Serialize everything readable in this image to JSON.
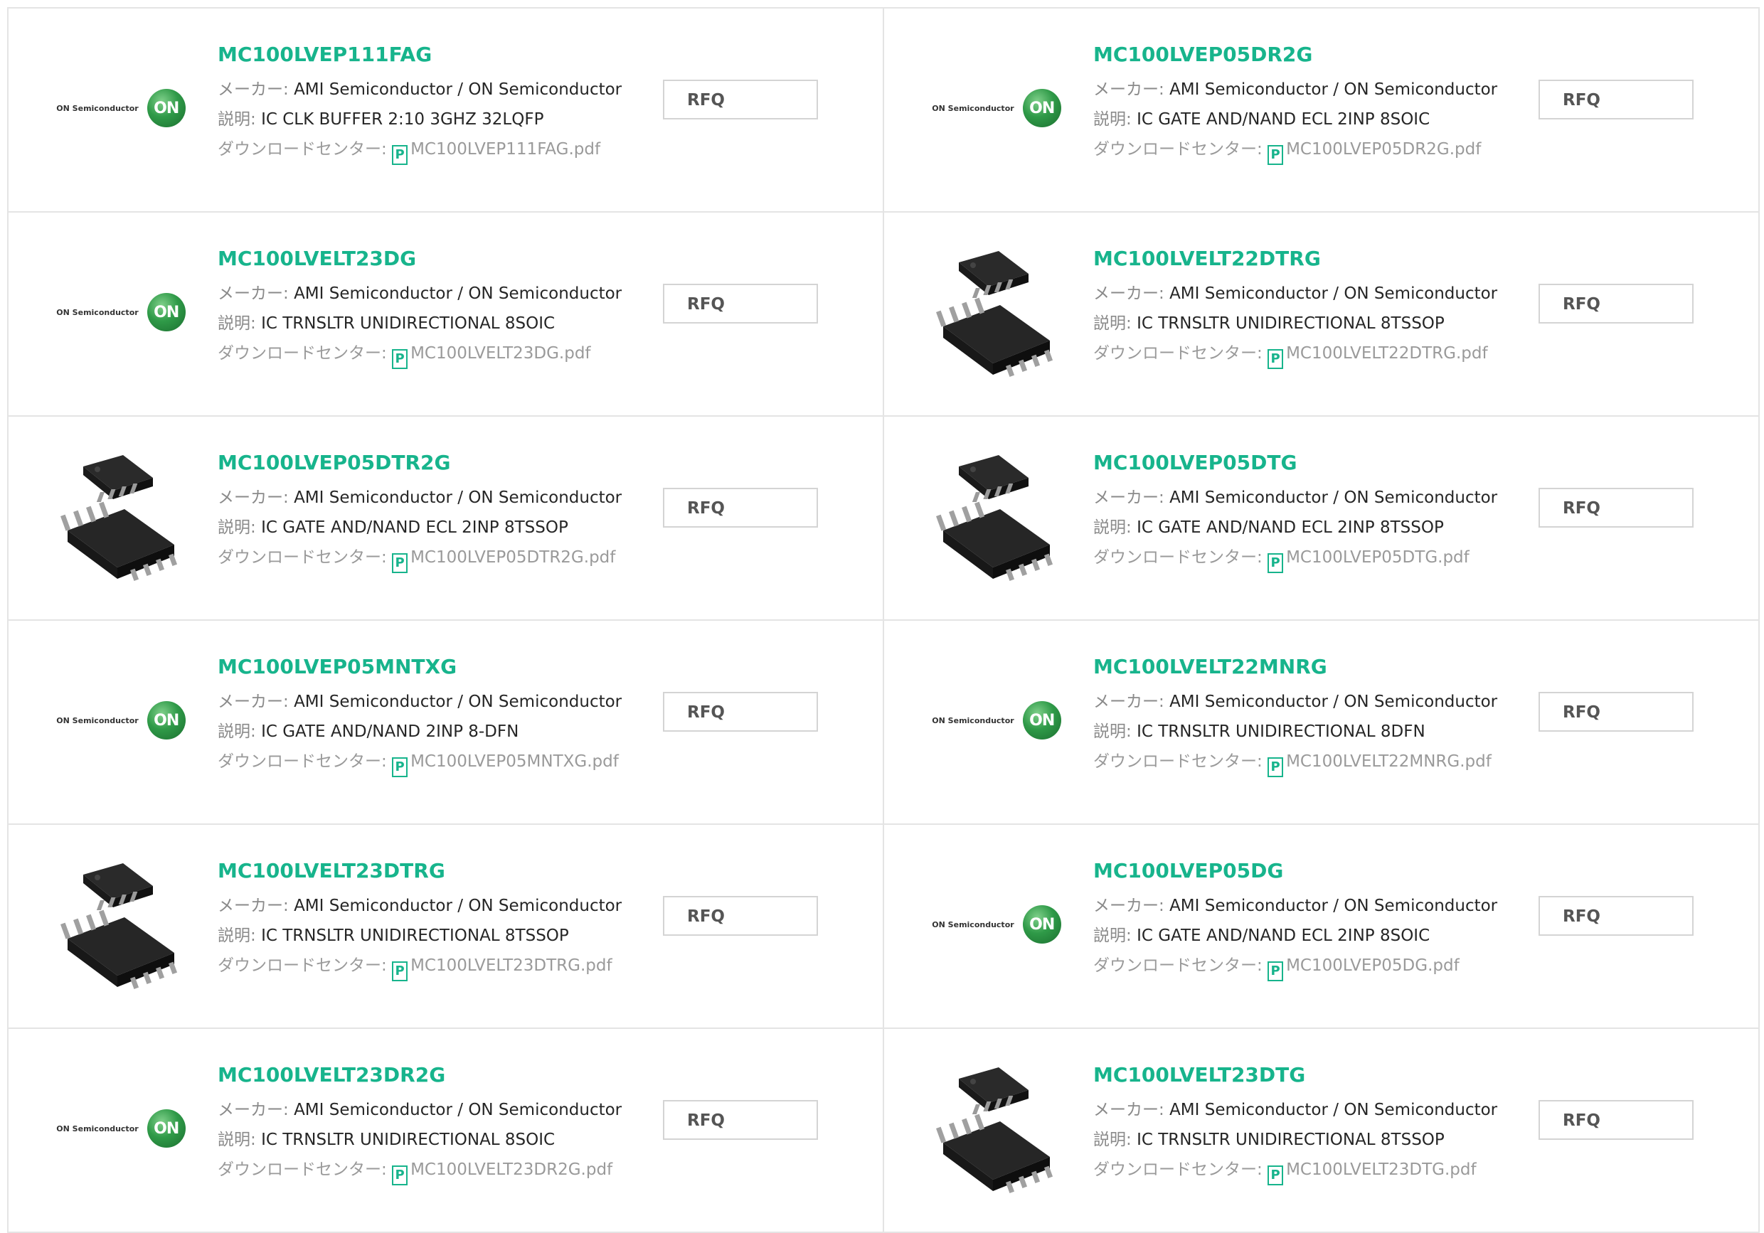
{
  "labels": {
    "maker": "メーカー: ",
    "description": "説明: ",
    "download": "ダウンロードセンター: ",
    "rfq": "RFQ",
    "pdf_glyph": "P"
  },
  "logo": {
    "brand_text": "ON Semiconductor",
    "circle_text": "ON",
    "brand_color": "#2f9a48"
  },
  "colors": {
    "part_number": "#17b48c",
    "border": "#e4e4e4"
  },
  "products": [
    {
      "part_number": "MC100LVEP111FAG",
      "maker": "AMI Semiconductor / ON Semiconductor",
      "description": "IC CLK BUFFER 2:10 3GHZ 32LQFP",
      "pdf": "MC100LVEP111FAG.pdf",
      "image": "on-semiconductor-logo"
    },
    {
      "part_number": "MC100LVEP05DR2G",
      "maker": "AMI Semiconductor / ON Semiconductor",
      "description": "IC GATE AND/NAND ECL 2INP 8SOIC",
      "pdf": "MC100LVEP05DR2G.pdf",
      "image": "on-semiconductor-logo"
    },
    {
      "part_number": "MC100LVELT23DG",
      "maker": "AMI Semiconductor / ON Semiconductor",
      "description": "IC TRNSLTR UNIDIRECTIONAL 8SOIC",
      "pdf": "MC100LVELT23DG.pdf",
      "image": "on-semiconductor-logo"
    },
    {
      "part_number": "MC100LVELT22DTRG",
      "maker": "AMI Semiconductor / ON Semiconductor",
      "description": "IC TRNSLTR UNIDIRECTIONAL 8TSSOP",
      "pdf": "MC100LVELT22DTRG.pdf",
      "image": "chip-package"
    },
    {
      "part_number": "MC100LVEP05DTR2G",
      "maker": "AMI Semiconductor / ON Semiconductor",
      "description": "IC GATE AND/NAND ECL 2INP 8TSSOP",
      "pdf": "MC100LVEP05DTR2G.pdf",
      "image": "chip-package"
    },
    {
      "part_number": "MC100LVEP05DTG",
      "maker": "AMI Semiconductor / ON Semiconductor",
      "description": "IC GATE AND/NAND ECL 2INP 8TSSOP",
      "pdf": "MC100LVEP05DTG.pdf",
      "image": "chip-package"
    },
    {
      "part_number": "MC100LVEP05MNTXG",
      "maker": "AMI Semiconductor / ON Semiconductor",
      "description": "IC GATE AND/NAND 2INP 8-DFN",
      "pdf": "MC100LVEP05MNTXG.pdf",
      "image": "on-semiconductor-logo"
    },
    {
      "part_number": "MC100LVELT22MNRG",
      "maker": "AMI Semiconductor / ON Semiconductor",
      "description": "IC TRNSLTR UNIDIRECTIONAL 8DFN",
      "pdf": "MC100LVELT22MNRG.pdf",
      "image": "on-semiconductor-logo"
    },
    {
      "part_number": "MC100LVELT23DTRG",
      "maker": "AMI Semiconductor / ON Semiconductor",
      "description": "IC TRNSLTR UNIDIRECTIONAL 8TSSOP",
      "pdf": "MC100LVELT23DTRG.pdf",
      "image": "chip-package"
    },
    {
      "part_number": "MC100LVEP05DG",
      "maker": "AMI Semiconductor / ON Semiconductor",
      "description": "IC GATE AND/NAND ECL 2INP 8SOIC",
      "pdf": "MC100LVEP05DG.pdf",
      "image": "on-semiconductor-logo"
    },
    {
      "part_number": "MC100LVELT23DR2G",
      "maker": "AMI Semiconductor / ON Semiconductor",
      "description": "IC TRNSLTR UNIDIRECTIONAL 8SOIC",
      "pdf": "MC100LVELT23DR2G.pdf",
      "image": "on-semiconductor-logo"
    },
    {
      "part_number": "MC100LVELT23DTG",
      "maker": "AMI Semiconductor / ON Semiconductor",
      "description": "IC TRNSLTR UNIDIRECTIONAL 8TSSOP",
      "pdf": "MC100LVELT23DTG.pdf",
      "image": "chip-package"
    }
  ]
}
